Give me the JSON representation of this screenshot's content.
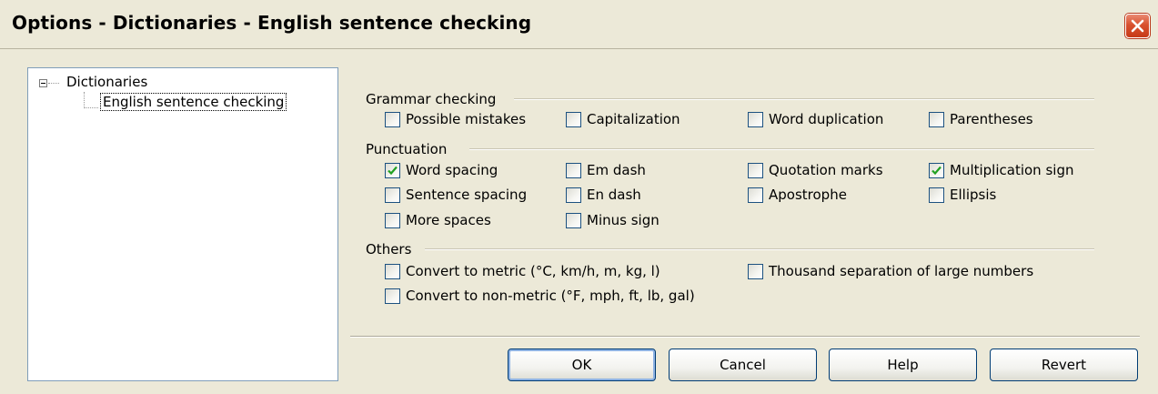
{
  "window": {
    "title": "Options - Dictionaries - English sentence checking"
  },
  "tree": {
    "root_label": "Dictionaries",
    "child_label": "English sentence checking"
  },
  "groups": {
    "grammar": {
      "label": "Grammar checking",
      "items": [
        {
          "label": "Possible mistakes",
          "checked": false
        },
        {
          "label": "Capitalization",
          "checked": false
        },
        {
          "label": "Word duplication",
          "checked": false
        },
        {
          "label": "Parentheses",
          "checked": false
        }
      ]
    },
    "punctuation": {
      "label": "Punctuation",
      "items": [
        {
          "label": "Word spacing",
          "checked": true
        },
        {
          "label": "Em dash",
          "checked": false
        },
        {
          "label": "Quotation marks",
          "checked": false
        },
        {
          "label": "Multiplication sign",
          "checked": true
        },
        {
          "label": "Sentence spacing",
          "checked": false
        },
        {
          "label": "En dash",
          "checked": false
        },
        {
          "label": "Apostrophe",
          "checked": false
        },
        {
          "label": "Ellipsis",
          "checked": false
        },
        {
          "label": "More spaces",
          "checked": false
        },
        {
          "label": "Minus sign",
          "checked": false
        }
      ]
    },
    "others": {
      "label": "Others",
      "items": [
        {
          "label": "Convert to metric (°C, km/h, m, kg, l)",
          "checked": false
        },
        {
          "label": "Thousand separation of large numbers",
          "checked": false
        },
        {
          "label": "Convert to non-metric (°F, mph, ft, lb, gal)",
          "checked": false
        }
      ]
    }
  },
  "buttons": {
    "ok": "OK",
    "cancel": "Cancel",
    "help": "Help",
    "revert": "Revert"
  },
  "colors": {
    "dialog_bg": "#ece9d8",
    "close_button": "#d9512f",
    "checkmark": "#21a121",
    "checkbox_border": "#1c5180"
  }
}
